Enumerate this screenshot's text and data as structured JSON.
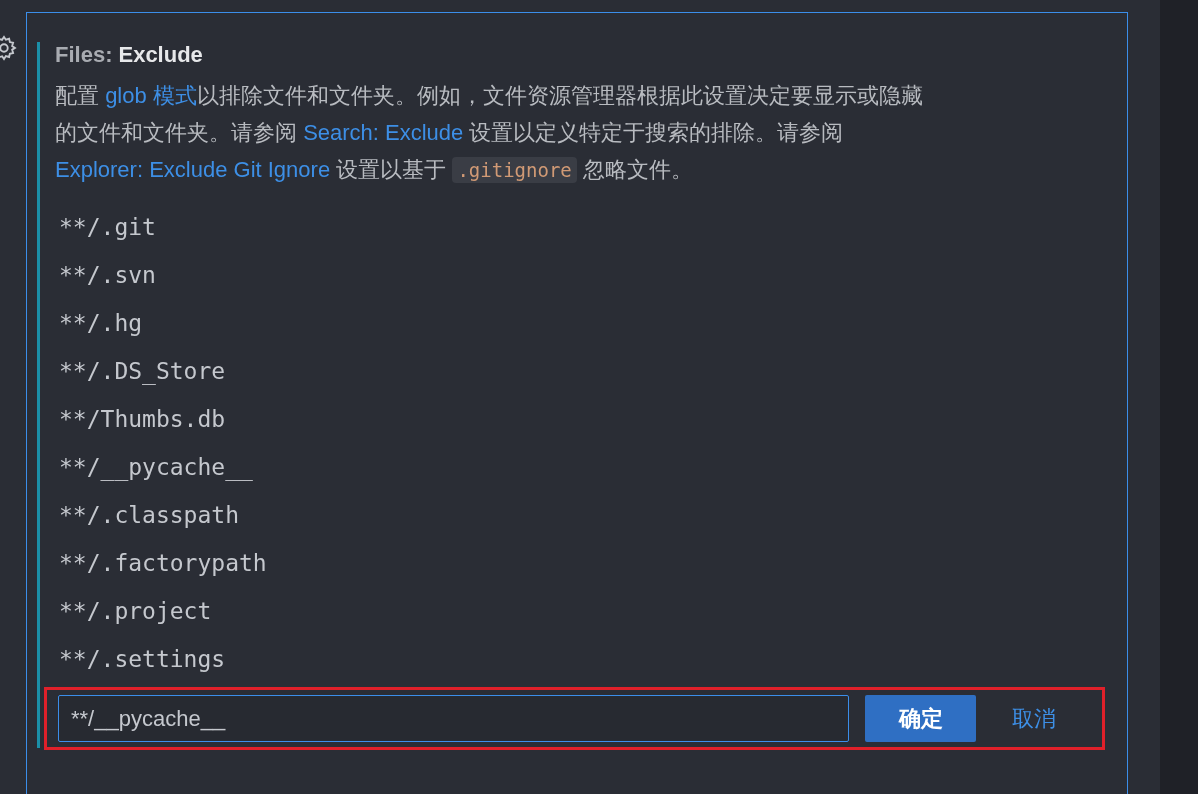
{
  "setting": {
    "category": "Files:",
    "name": "Exclude",
    "description_lines": [
      [
        {
          "kind": "text",
          "text": "配置 "
        },
        {
          "kind": "link",
          "text": "glob 模式"
        },
        {
          "kind": "text",
          "text": "以排除文件和文件夹。例如，文件资源管理器根据此设置决定要显示或隐藏"
        }
      ],
      [
        {
          "kind": "text",
          "text": "的文件和文件夹。请参阅 "
        },
        {
          "kind": "link",
          "text": "Search: Exclude"
        },
        {
          "kind": "text",
          "text": " 设置以定义特定于搜索的排除。请参阅"
        }
      ],
      [
        {
          "kind": "link",
          "text": "Explorer: Exclude Git Ignore"
        },
        {
          "kind": "text",
          "text": " 设置以基于 "
        },
        {
          "kind": "code",
          "text": ".gitignore"
        },
        {
          "kind": "text",
          "text": " 忽略文件。"
        }
      ]
    ],
    "patterns": [
      "**/.git",
      "**/.svn",
      "**/.hg",
      "**/.DS_Store",
      "**/Thumbs.db",
      "**/__pycache__",
      "**/.classpath",
      "**/.factorypath",
      "**/.project",
      "**/.settings"
    ],
    "edit_value": "**/__pycache__",
    "ok_button": "确定",
    "cancel_button": "取消"
  }
}
